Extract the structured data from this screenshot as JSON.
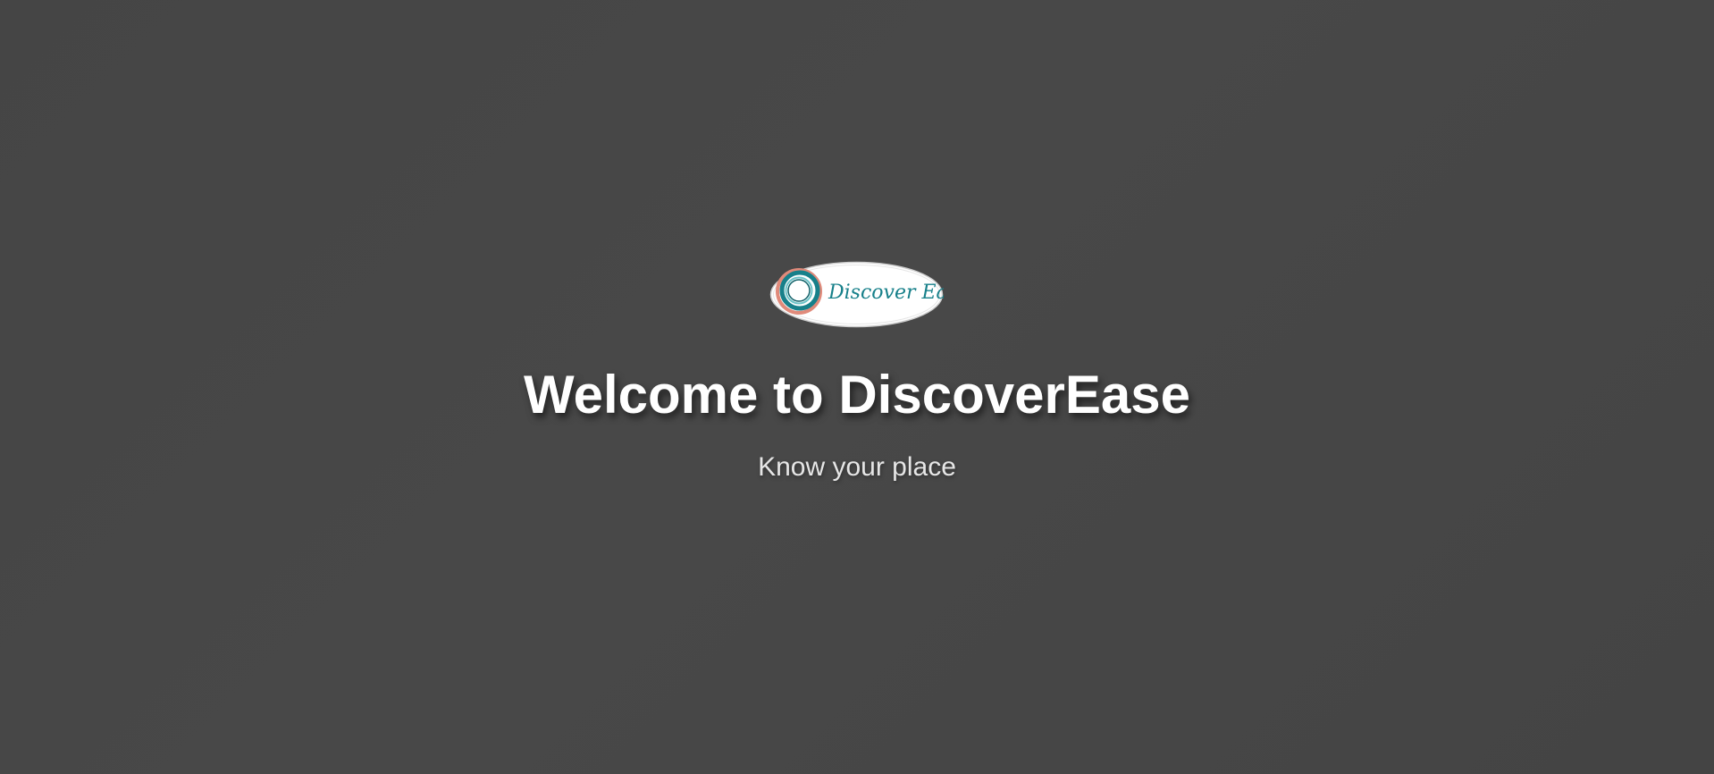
{
  "logo": {
    "wordmark": "Discover Ease",
    "colors": {
      "teal": "#17808a",
      "coral": "#e08a7a",
      "ring_light": "#6cc3c8"
    }
  },
  "hero": {
    "title": "Welcome to DiscoverEase",
    "subtitle": "Know your place"
  }
}
